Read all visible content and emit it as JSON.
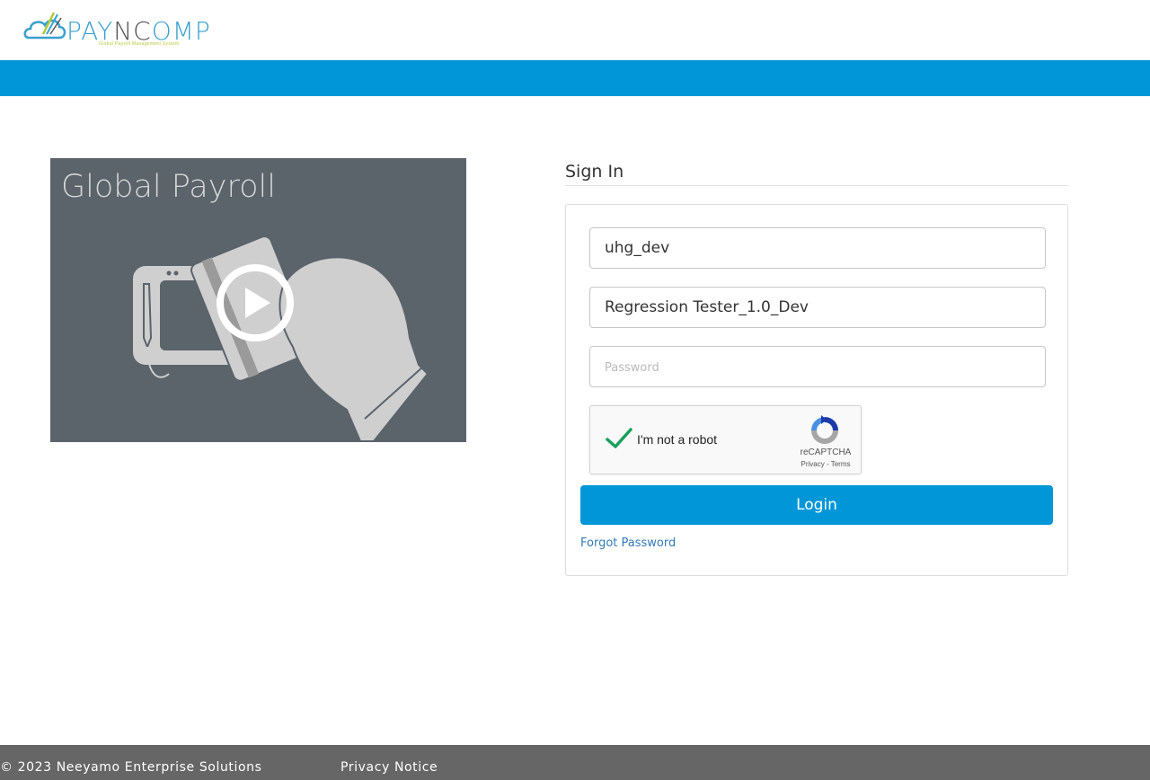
{
  "header": {
    "logo_text_a": "PAY",
    "logo_text_b": "NC",
    "logo_text_c": "OMP",
    "logo_tagline": "Global Payroll Management System"
  },
  "video": {
    "title": "Global Payroll",
    "icon": "play-icon"
  },
  "signin": {
    "title": "Sign In",
    "username_value": "uhg_dev",
    "role_value": "Regression Tester_1.0_Dev",
    "password_placeholder": "Password",
    "captcha": {
      "label": "I'm not a robot",
      "brand": "reCAPTCHA",
      "privacy": "Privacy",
      "separator": " - ",
      "terms": "Terms",
      "checked": true
    },
    "login_label": "Login",
    "forgot_label": "Forgot Password"
  },
  "footer": {
    "copyright": "© 2023 Neeyamo Enterprise Solutions",
    "privacy": "Privacy Notice"
  },
  "colors": {
    "brand_blue": "#0096d8",
    "video_bg": "#5b636b",
    "footer_bg": "#666666",
    "check_green": "#1a9f5a"
  }
}
